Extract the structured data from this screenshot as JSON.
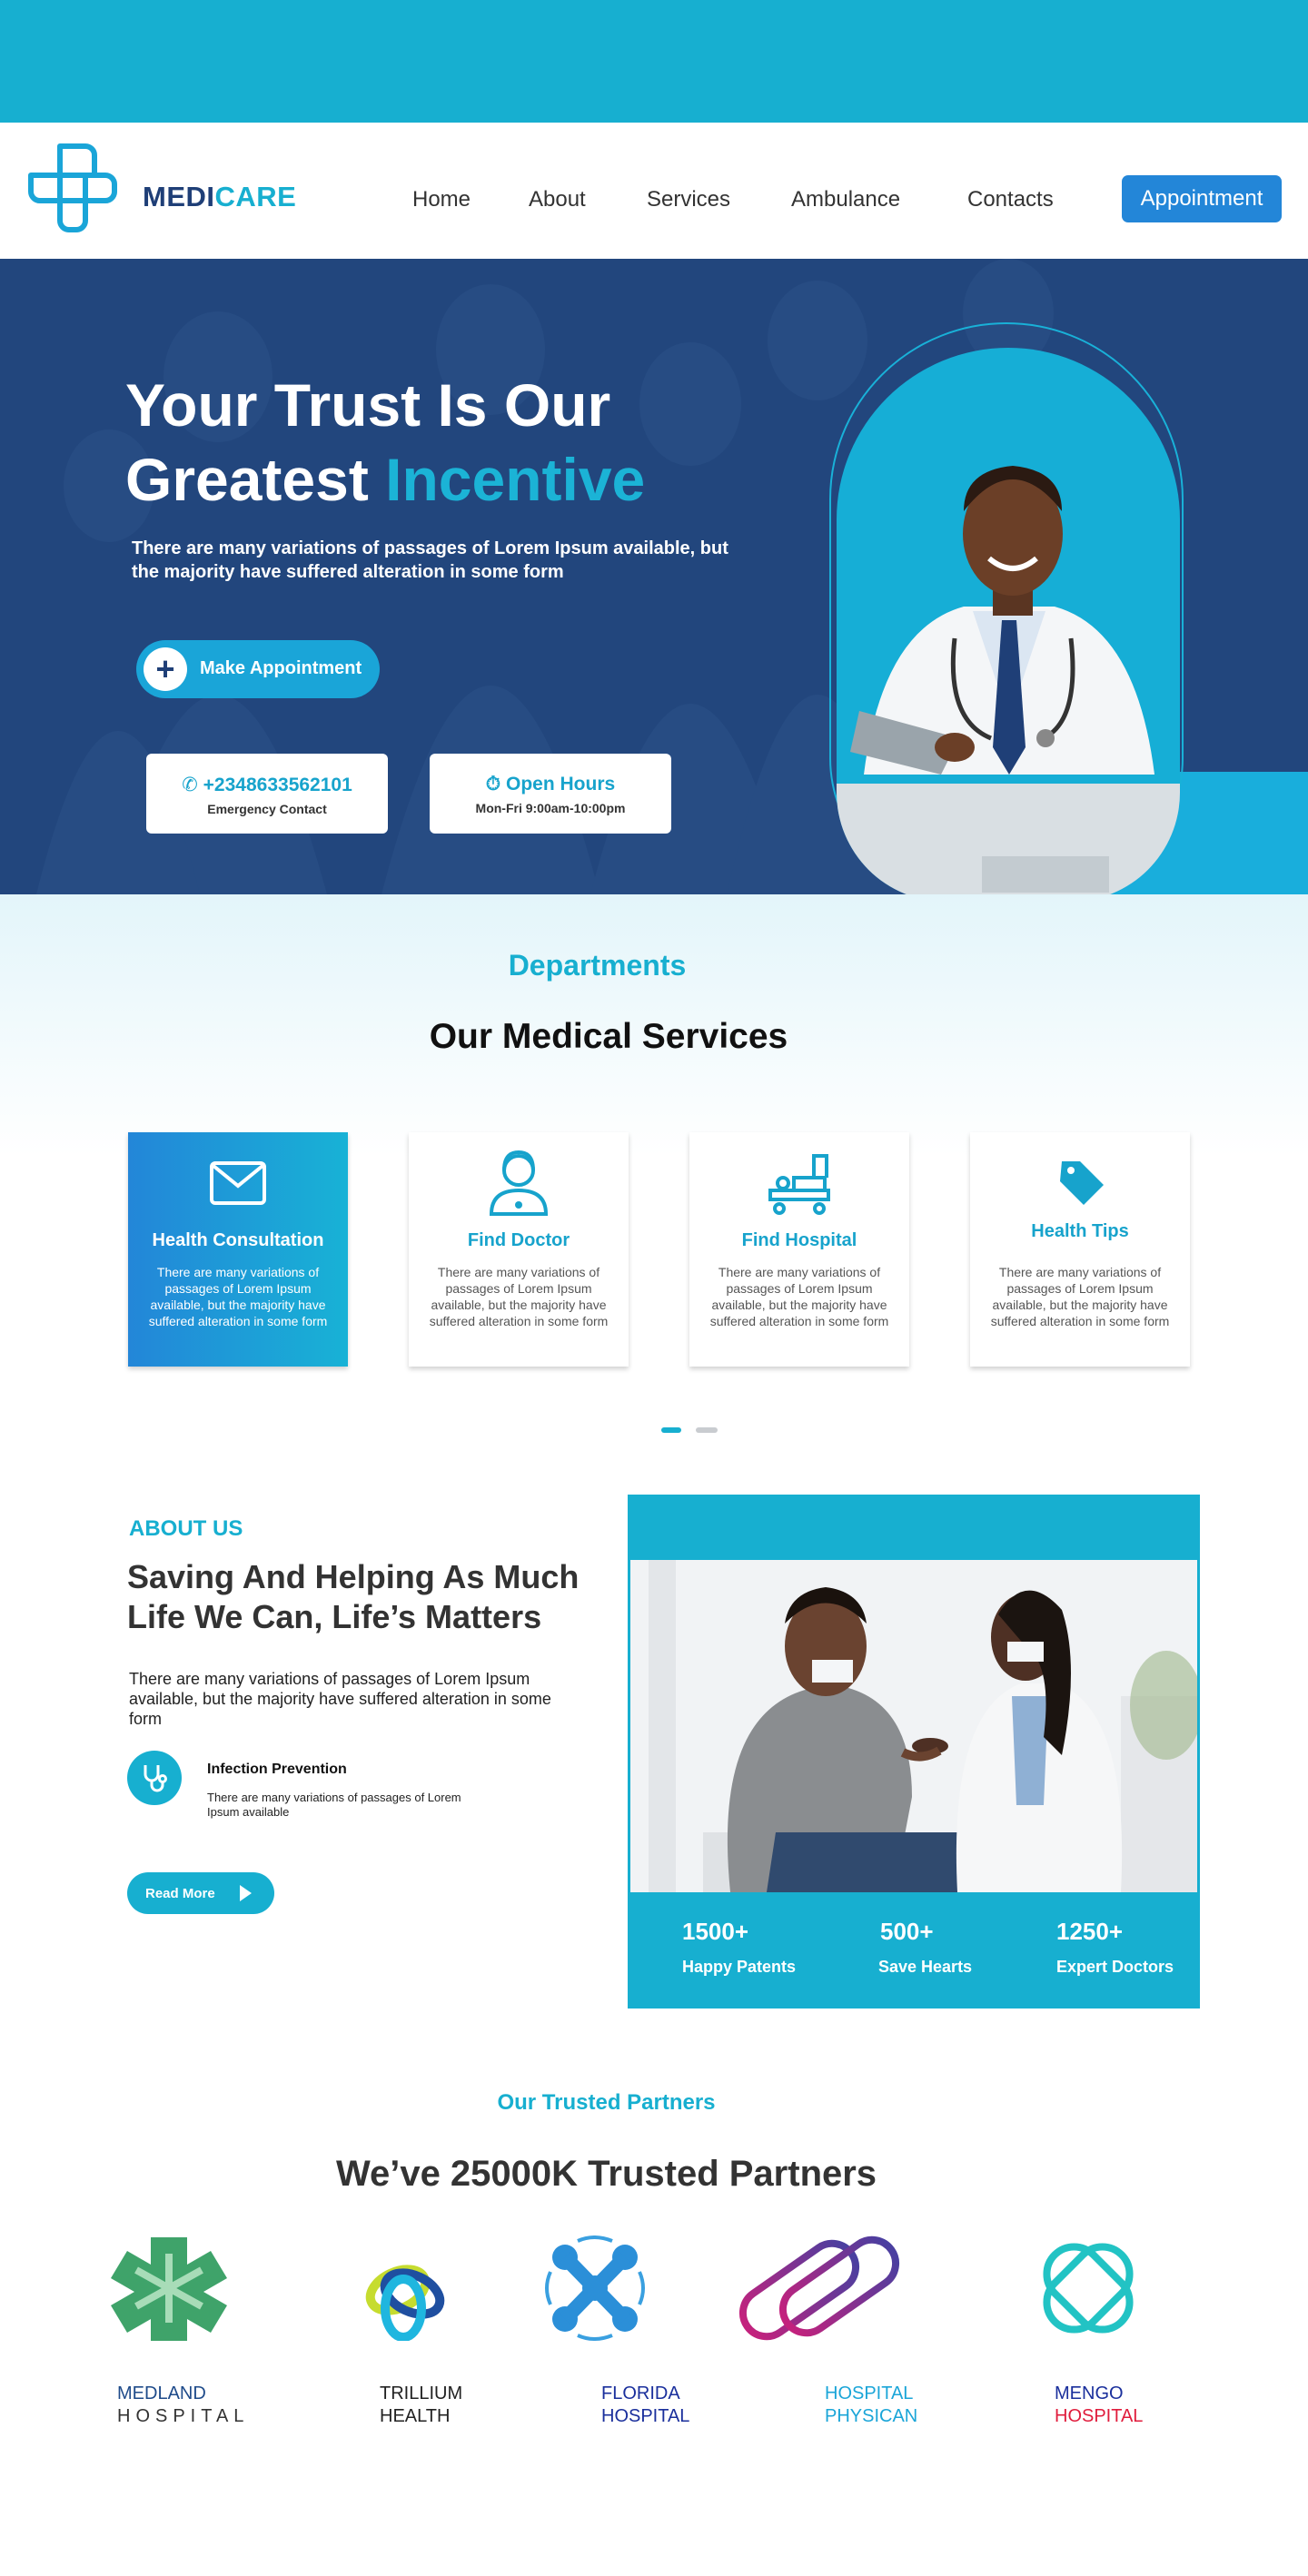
{
  "brand": {
    "part1": "MEDI",
    "part2": "CARE"
  },
  "nav": {
    "home": "Home",
    "about": "About",
    "services": "Services",
    "ambulance": "Ambulance",
    "contacts": "Contacts",
    "appointment": "Appointment"
  },
  "hero": {
    "title_line1": "Your Trust Is Our",
    "title_line2_plain": "Greatest ",
    "title_line2_highlight": "Incentive",
    "subtitle": "There are many variations of passages of Lorem Ipsum available, but the majority have suffered alteration in some form",
    "cta": "Make Appointment",
    "phone": "+2348633562101",
    "phone_label": "Emergency Contact",
    "hours_title": "Open Hours",
    "hours": "Mon-Fri 9:00am-10:00pm"
  },
  "departments": {
    "kicker": "Departments",
    "title": "Our Medical Services",
    "items": [
      {
        "title": "Health Consultation",
        "desc": "There are many variations of passages of Lorem Ipsum available, but the majority have suffered alteration in some form",
        "icon": "envelope-icon"
      },
      {
        "title": "Find Doctor",
        "desc": "There are many variations of passages of Lorem Ipsum available, but the majority have suffered alteration in some form",
        "icon": "doctor-icon"
      },
      {
        "title": "Find Hospital",
        "desc": "There are many variations of passages of Lorem Ipsum available, but the majority have suffered alteration in some form",
        "icon": "hospital-bed-icon"
      },
      {
        "title": "Health Tips",
        "desc": "There are many variations of passages of Lorem Ipsum available, but the majority have suffered alteration in some form",
        "icon": "tag-icon"
      }
    ]
  },
  "about": {
    "kicker": "ABOUT US",
    "title": "Saving  And Helping As Much Life We Can, Life’s Matters",
    "text": "There are many variations of passages of Lorem Ipsum available, but the majority have suffered alteration in some form",
    "feature_title": "Infection Prevention",
    "feature_text": "There are many variations of passages of Lorem Ipsum available",
    "read_more": "Read More",
    "stats": [
      {
        "value": "1500+",
        "label": "Happy Patents"
      },
      {
        "value": "500+",
        "label": "Save Hearts"
      },
      {
        "value": "1250+",
        "label": "Expert Doctors"
      }
    ]
  },
  "partners": {
    "kicker": "Our Trusted Partners",
    "title": "We’ve 25000K Trusted Partners",
    "items": [
      {
        "line1": "MEDLAND",
        "line2": "HOSPITAL"
      },
      {
        "line1": "TRILLIUM",
        "line2": "HEALTH"
      },
      {
        "line1": "FLORIDA",
        "line2": "HOSPITAL"
      },
      {
        "line1": "HOSPITAL",
        "line2": "PHYSICAN"
      },
      {
        "line1": "MENGO",
        "line2": "HOSPITAL"
      }
    ]
  },
  "colors": {
    "primary": "#17afd0",
    "navy": "#22467d",
    "blue": "#2386d8"
  }
}
